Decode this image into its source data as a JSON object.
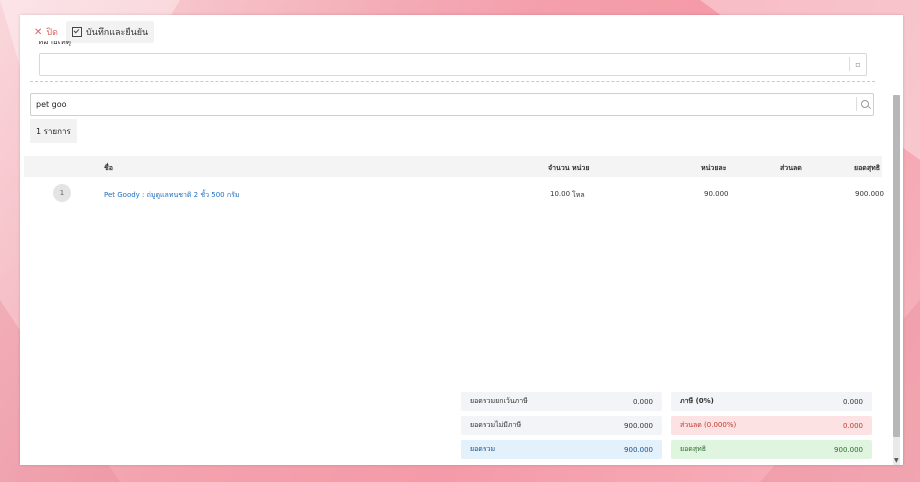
{
  "toolbar": {
    "close_label": "ปิด",
    "save_confirm_label": "บันทึกและยืนยัน"
  },
  "note": {
    "label": "หมายเหตุ",
    "value": ""
  },
  "search": {
    "value": "pet goo"
  },
  "result_count": "1 รายการ",
  "table": {
    "headers": {
      "name": "ชื่อ",
      "qty": "จำนวน",
      "unit": "หน่วย",
      "unit_price": "หน่วยละ",
      "discount": "ส่วนลด",
      "net": "ยอดสุทธิ"
    },
    "rows": [
      {
        "no": "1",
        "name": "Pet Goody : ถ่มูดูแลทนชาติ 2 ชั้ว 500 กรัม",
        "qty": "10.00",
        "unit": "โหล",
        "unit_price": "90.000",
        "discount": "",
        "net": "900.000"
      }
    ]
  },
  "summary": {
    "exempt_label": "ยอดรวมยกเว้นภาษี",
    "exempt_value": "0.000",
    "tax_label": "ภาษี (0%)",
    "tax_value": "0.000",
    "nontax_label": "ยอดรวมไม่มีภาษี",
    "nontax_value": "900.000",
    "discount_label": "ส่วนลด (0.000%)",
    "discount_value": "0.000",
    "total_label": "ยอดรวม",
    "total_value": "900.000",
    "net_label": "ยอดสุทธิ",
    "net_value": "900.000"
  }
}
